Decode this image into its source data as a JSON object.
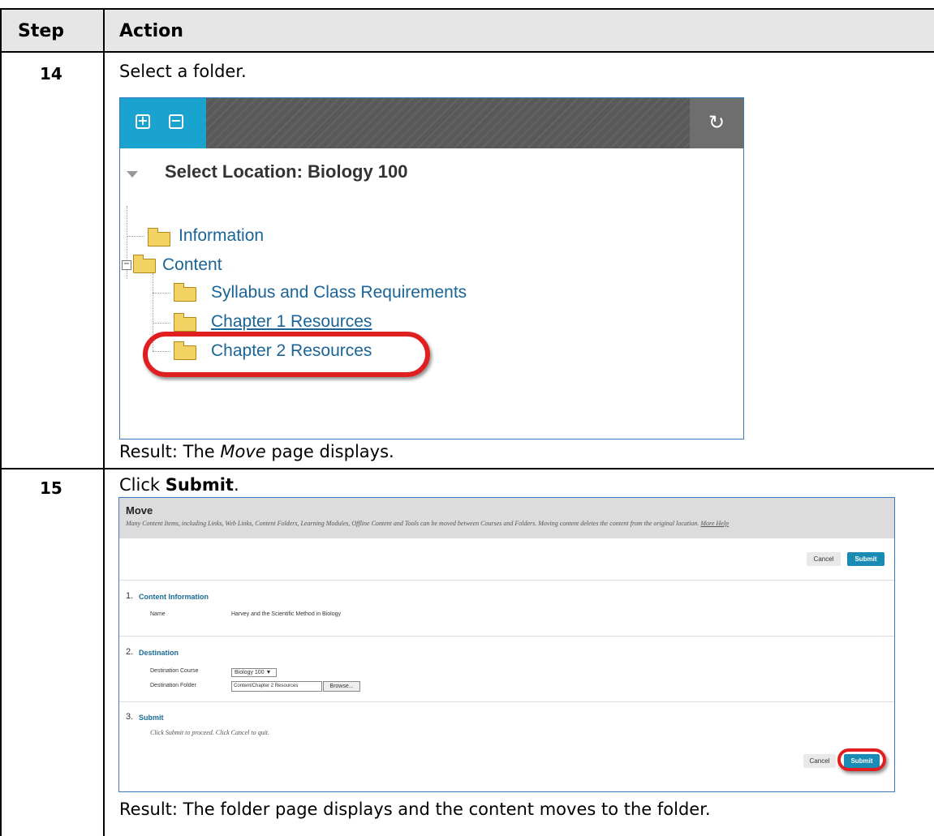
{
  "table": {
    "headers": [
      "Step",
      "Action"
    ],
    "rows": [
      {
        "step": "14",
        "instruction_prefix": "Select a folder.",
        "result_prefix": "Result: The ",
        "result_italic": "Move",
        "result_suffix": " page displays."
      },
      {
        "step": "15",
        "instruction_prefix": "Click ",
        "instruction_bold": "Submit",
        "instruction_suffix": ".",
        "result": "Result: The folder page displays and the content moves to the folder."
      }
    ]
  },
  "screenshot1": {
    "location_label": "Select Location: Biology 100",
    "tree": [
      {
        "label": "Information",
        "level": 0
      },
      {
        "label": "Content",
        "level": 0,
        "expanded": true
      },
      {
        "label": "Syllabus and Class Requirements",
        "level": 1
      },
      {
        "label": "Chapter 1 Resources",
        "level": 1
      },
      {
        "label": "Chapter 2 Resources",
        "level": 1,
        "highlighted": true
      }
    ],
    "icons": {
      "expand": "plus-icon",
      "collapse": "minus-icon",
      "refresh": "refresh-icon",
      "folder": "folder-icon"
    },
    "accent": "#1aa3cf",
    "highlight_color": "#e02020"
  },
  "screenshot2": {
    "title": "Move",
    "description": "Many Content Items, including Links, Web Links, Content Folders, Learning Modules, Offline Content and Tools can be moved between Courses and Folders. Moving content deletes the content from the original location.",
    "help_link": "More Help",
    "cancel_label": "Cancel",
    "submit_label": "Submit",
    "sections": [
      {
        "number": "1.",
        "title": "Content Information"
      },
      {
        "number": "2.",
        "title": "Destination"
      },
      {
        "number": "3.",
        "title": "Submit"
      }
    ],
    "name_label": "Name",
    "name_value": "Harvey and the Scientific Method in Biology",
    "dest_course_label": "Destination Course",
    "dest_course_value": "Biology 100",
    "dest_folder_label": "Destination Folder",
    "dest_folder_value": "Content/Chapter 2 Resources",
    "browse_label": "Browse...",
    "submit_help": "Click Submit to proceed. Click Cancel to quit.",
    "submit_color": "#1a8bb5"
  }
}
